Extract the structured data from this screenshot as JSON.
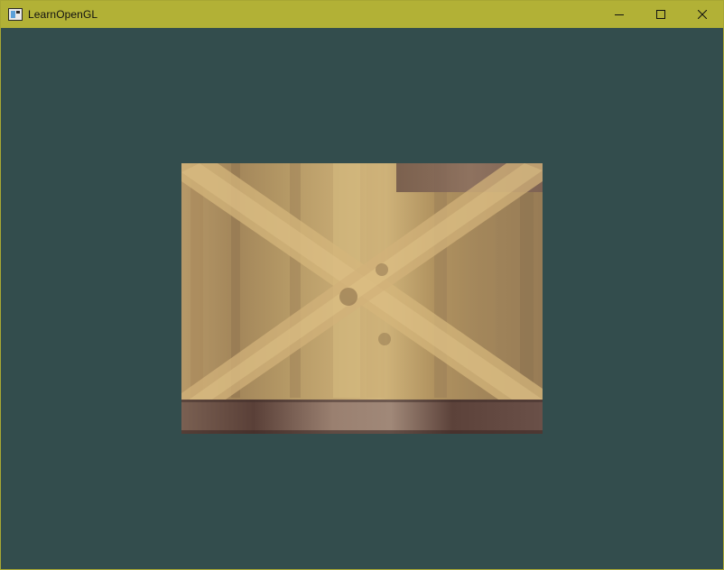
{
  "window": {
    "title": "LearnOpenGL",
    "title_color": "#b2b136",
    "clear_color": "#334d4d"
  },
  "titlebar": {
    "app_icon": "window-app-icon",
    "buttons": [
      {
        "name": "minimize-button",
        "icon": "minimize-icon"
      },
      {
        "name": "maximize-button",
        "icon": "maximize-icon"
      },
      {
        "name": "close-button",
        "icon": "close-icon"
      }
    ]
  },
  "scene": {
    "object": "textured-quad",
    "texture": "wooden-container",
    "colors": {
      "wood_light": "#c4a56a",
      "wood_mid": "#a88a55",
      "wood_dark": "#6e5440",
      "edge_dark": "#4a3530"
    }
  }
}
